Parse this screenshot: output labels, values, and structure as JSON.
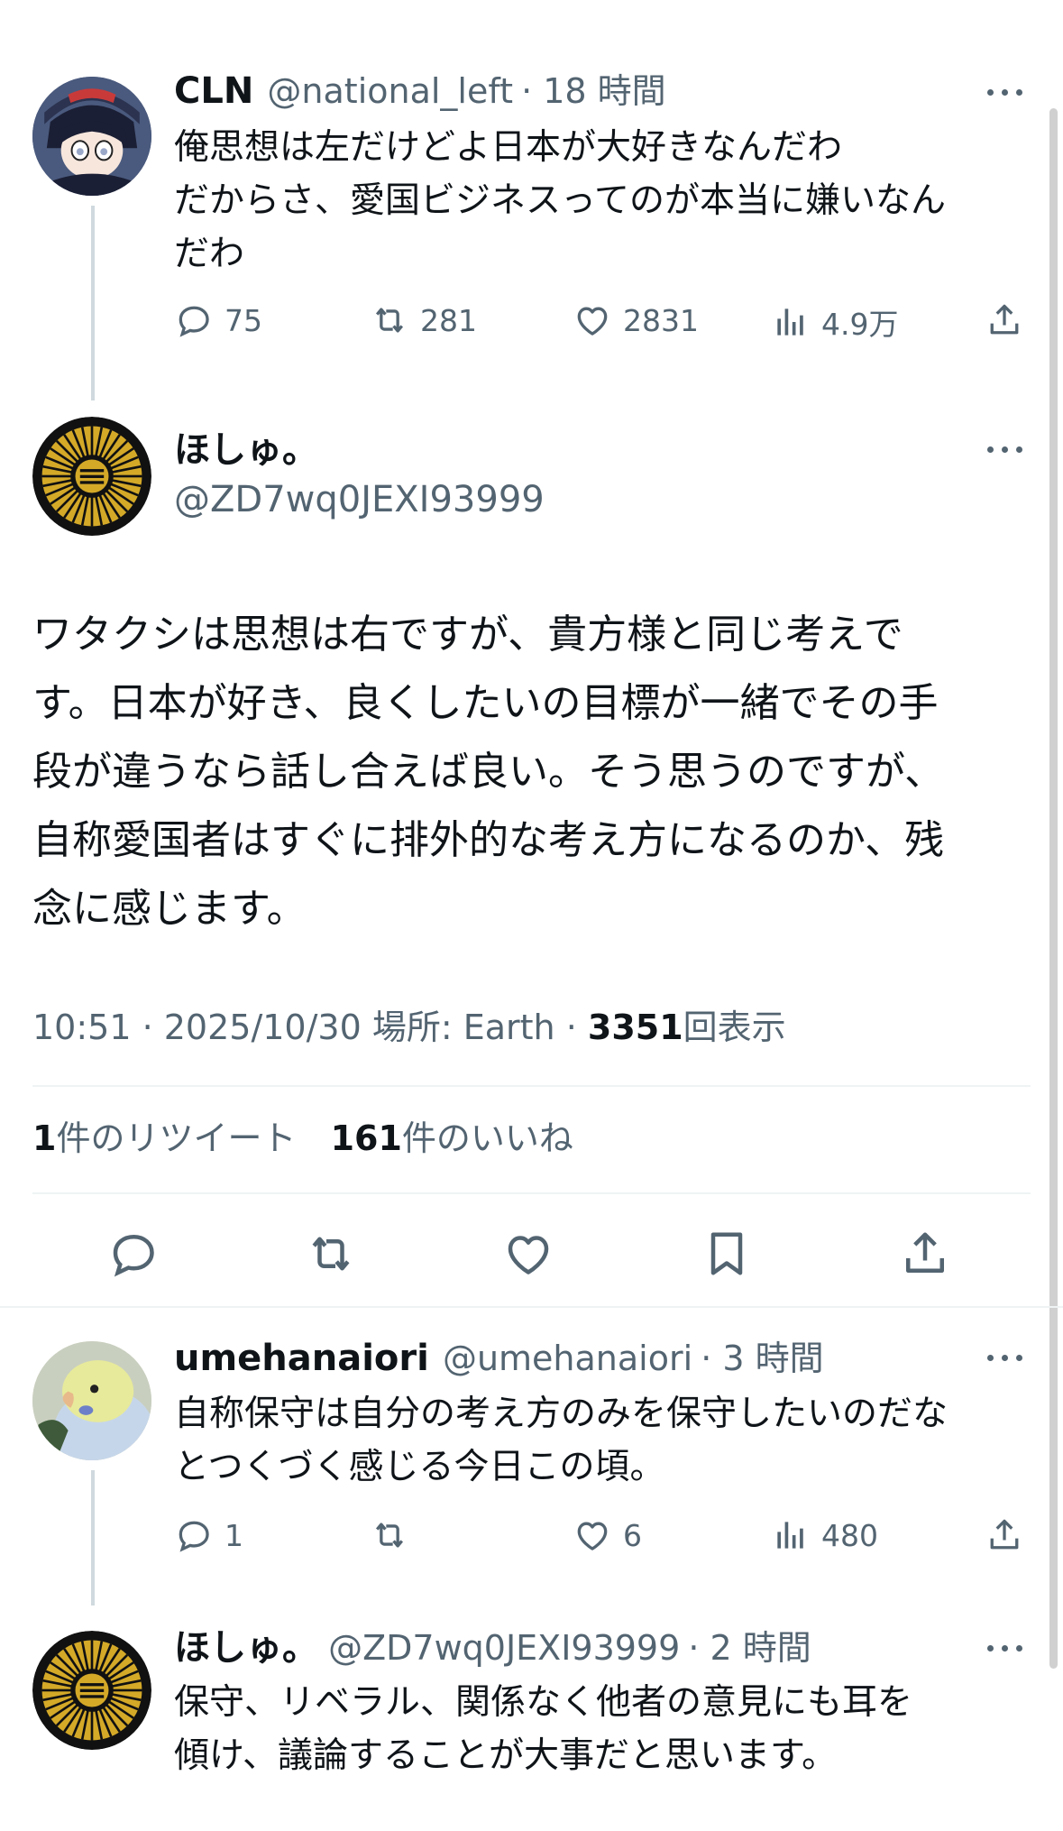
{
  "posts": [
    {
      "name": "CLN",
      "handle": "@national_left",
      "time": "· 18 時間",
      "lines": [
        "俺思想は左だけどよ日本が大好きなんだわ",
        "だからさ、愛国ビジネスってのが本当に嫌いなん",
        "だわ"
      ],
      "replies": "75",
      "retweets": "281",
      "likes": "2831",
      "views": "4.9万"
    },
    {
      "name": "umehanaiori",
      "handle": "@umehanaiori",
      "time": "· 3 時間",
      "lines": [
        "自称保守は自分の考え方のみを保守したいのだな",
        "とつくづく感じる今日この頃。"
      ],
      "replies": "1",
      "retweets": "",
      "likes": "6",
      "views": "480"
    },
    {
      "name": "ほしゅ。",
      "handle": "@ZD7wq0JEXI93999",
      "time": "· 2 時間",
      "lines": [
        "保守、リベラル、関係なく他者の意見にも耳を",
        "傾け、議論することが大事だと思います。"
      ]
    }
  ],
  "main": {
    "name": "ほしゅ。",
    "handle": "@ZD7wq0JEXI93999",
    "lines": [
      "ワタクシは思想は右ですが、貴方様と同じ考えで",
      "す。日本が好き、良くしたいの目標が一緒でその手",
      "段が違うなら話し合えば良い。そう思うのですが、",
      "自称愛国者はすぐに排外的な考え方になるのか、残",
      "念に感じます。"
    ],
    "meta_time": "10:51 · 2025/10/30 場所: Earth ·",
    "meta_views_count": "3351",
    "meta_views_label": "回表示",
    "retweet_count": "1",
    "retweet_label": "件のリツイート",
    "like_count": "161",
    "like_label": "件のいいね"
  },
  "icons": {
    "reply": "reply-icon",
    "retweet": "retweet-icon",
    "like": "heart-icon",
    "views": "views-icon",
    "bookmark": "bookmark-icon",
    "share": "share-icon",
    "more": "more-icon"
  },
  "colors": {
    "text": "#0f1419",
    "muted": "#536471",
    "line": "#cfd9de",
    "gold": "#d4a928"
  }
}
